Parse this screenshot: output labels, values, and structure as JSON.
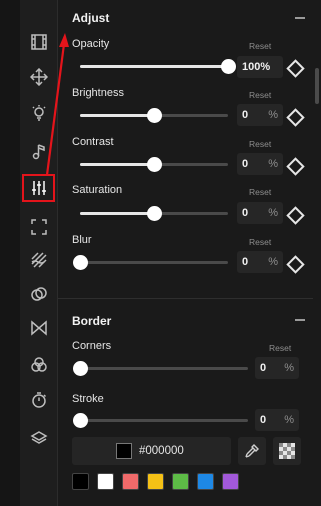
{
  "toolbar": {
    "tools": [
      {
        "icon": "film-icon",
        "active": false
      },
      {
        "icon": "move-icon",
        "active": false
      },
      {
        "icon": "lightbulb-icon",
        "active": false
      },
      {
        "icon": "music-icon",
        "active": false
      },
      {
        "icon": "adjust-sliders-icon",
        "active": true
      },
      {
        "icon": "crop-frame-icon",
        "active": false
      },
      {
        "icon": "texture-icon",
        "active": false
      },
      {
        "icon": "blend-circles-icon",
        "active": false
      },
      {
        "icon": "transition-icon",
        "active": false
      },
      {
        "icon": "color-circles-icon",
        "active": false
      },
      {
        "icon": "timer-icon",
        "active": false
      },
      {
        "icon": "layers-icon",
        "active": false
      }
    ]
  },
  "adjust": {
    "title": "Adjust",
    "opacity": {
      "label": "Opacity",
      "reset": "Reset",
      "value": "100",
      "unit": "%",
      "level": 1.0
    },
    "brightness": {
      "label": "Brightness",
      "reset": "Reset",
      "value": "0",
      "unit": "%",
      "level": 0.5
    },
    "contrast": {
      "label": "Contrast",
      "reset": "Reset",
      "value": "0",
      "unit": "%",
      "level": 0.5
    },
    "saturation": {
      "label": "Saturation",
      "reset": "Reset",
      "value": "0",
      "unit": "%",
      "level": 0.5
    },
    "blur": {
      "label": "Blur",
      "reset": "Reset",
      "value": "0",
      "unit": "%",
      "level": 0.0
    }
  },
  "border": {
    "title": "Border",
    "corners": {
      "label": "Corners",
      "reset": "Reset",
      "value": "0",
      "unit": "%",
      "level": 0.0
    },
    "stroke": {
      "label": "Stroke",
      "value": "0",
      "unit": "%",
      "level": 0.0
    },
    "color_value": "#000000",
    "swatches": [
      "#000000",
      "#ffffff",
      "#f06a6a",
      "#f5c116",
      "#5dbb46",
      "#1e88e5",
      "#a259d9"
    ]
  },
  "colors": {
    "accent_highlight": "#e4141b",
    "background": "#1a1a1a"
  }
}
